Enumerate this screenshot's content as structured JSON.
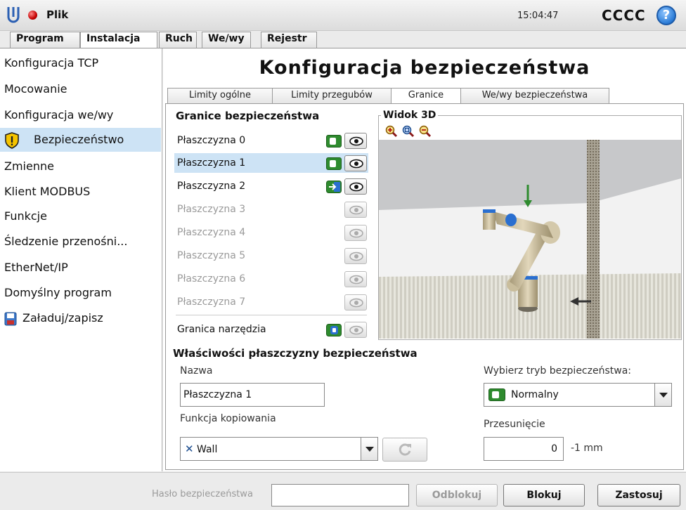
{
  "titlebar": {
    "file_label": "Plik",
    "clock": "15:04:47",
    "robot_name": "CCCC",
    "help_label": "?"
  },
  "main_tabs": [
    {
      "label": "Program"
    },
    {
      "label": "Instalacja"
    },
    {
      "label": "Ruch"
    },
    {
      "label": "We/wy"
    },
    {
      "label": "Rejestr"
    }
  ],
  "sidebar": {
    "items": [
      {
        "label": "Konfiguracja TCP"
      },
      {
        "label": "Mocowanie"
      },
      {
        "label": "Konfiguracja we/wy"
      },
      {
        "label": "Bezpieczeństwo"
      },
      {
        "label": "Zmienne"
      },
      {
        "label": "Klient MODBUS"
      },
      {
        "label": "Funkcje"
      },
      {
        "label": "Śledzenie przenośni..."
      },
      {
        "label": "EtherNet/IP"
      },
      {
        "label": "Domyślny program"
      },
      {
        "label": "Załaduj/zapisz"
      }
    ]
  },
  "page": {
    "title": "Konfiguracja bezpieczeństwa",
    "sub_tabs": [
      {
        "label": "Limity ogólne"
      },
      {
        "label": "Limity przegubów"
      },
      {
        "label": "Granice"
      },
      {
        "label": "We/wy bezpieczeństwa"
      }
    ]
  },
  "boundaries": {
    "title": "Granice bezpieczeństwa",
    "planes": [
      {
        "label": "Płaszczyzna 0"
      },
      {
        "label": "Płaszczyzna 1"
      },
      {
        "label": "Płaszczyzna 2"
      },
      {
        "label": "Płaszczyzna 3"
      },
      {
        "label": "Płaszczyzna 4"
      },
      {
        "label": "Płaszczyzna 5"
      },
      {
        "label": "Płaszczyzna 6"
      },
      {
        "label": "Płaszczyzna 7"
      }
    ],
    "tool_boundary": "Granica narzędzia"
  },
  "view3d": {
    "title": "Widok 3D"
  },
  "properties": {
    "title": "Właściwości płaszczyzny bezpieczeństwa",
    "name_label": "Nazwa",
    "name_value": "Płaszczyzna 1",
    "copy_label": "Funkcja kopiowania",
    "copy_value": "Wall",
    "mode_label": "Wybierz tryb bezpieczeństwa:",
    "mode_value": "Normalny",
    "offset_label": "Przesunięcie",
    "offset_value": "0",
    "offset_unit": "-1 mm"
  },
  "bottom": {
    "password_label": "Hasło bezpieczeństwa",
    "password_value": "",
    "unlock_label": "Odblokuj",
    "lock_label": "Blokuj",
    "apply_label": "Zastosuj"
  },
  "colors": {
    "selection": "#cde3f5",
    "toggle_green": "#2e8b2e",
    "toggle_blue": "#2a6fd0"
  }
}
